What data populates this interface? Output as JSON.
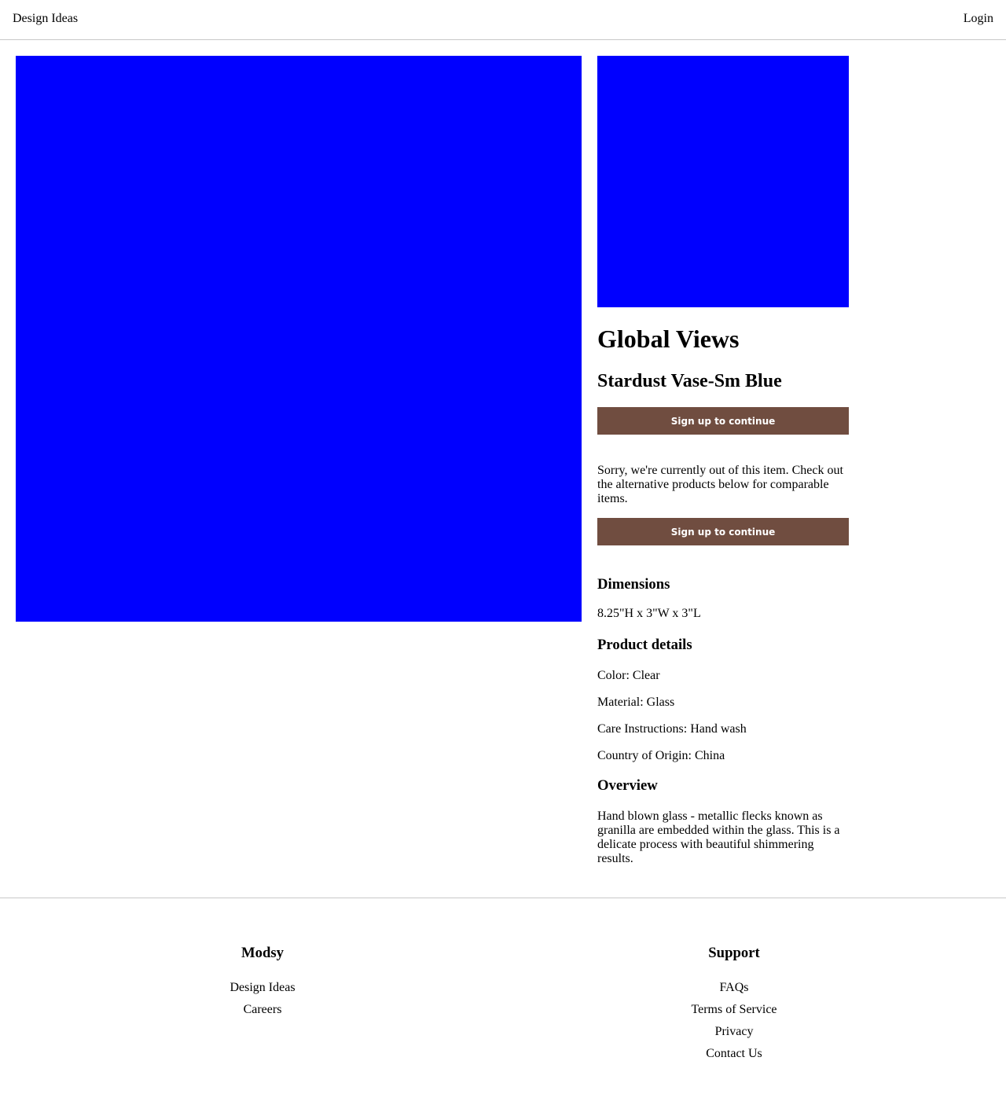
{
  "header": {
    "left_link": "Design Ideas",
    "right_link": "Login"
  },
  "product": {
    "image_color": "#0000ff",
    "brand": "Global Views",
    "name": "Stardust Vase-Sm Blue",
    "cta_label": "Sign up to continue",
    "cta_color": "#704d40",
    "out_of_stock": "Sorry, we're currently out of this item. Check out the alternative products below for comparable items.",
    "cta_label_2": "Sign up to continue",
    "dimensions_title": "Dimensions",
    "dimensions": "8.25\"H x 3\"W x 3\"L",
    "details_title": "Product details",
    "details": [
      "Color: Clear",
      "Material: Glass",
      "Care Instructions: Hand wash",
      "Country of Origin: China"
    ],
    "overview_title": "Overview",
    "overview": "Hand blown glass - metallic flecks known as granilla are embedded within the glass. This is a delicate process with beautiful shimmering results."
  },
  "footer": {
    "col1": {
      "title": "Modsy",
      "links": [
        "Design Ideas",
        "Careers"
      ]
    },
    "col2": {
      "title": "Support",
      "links": [
        "FAQs",
        "Terms of Service",
        "Privacy",
        "Contact Us"
      ]
    }
  }
}
